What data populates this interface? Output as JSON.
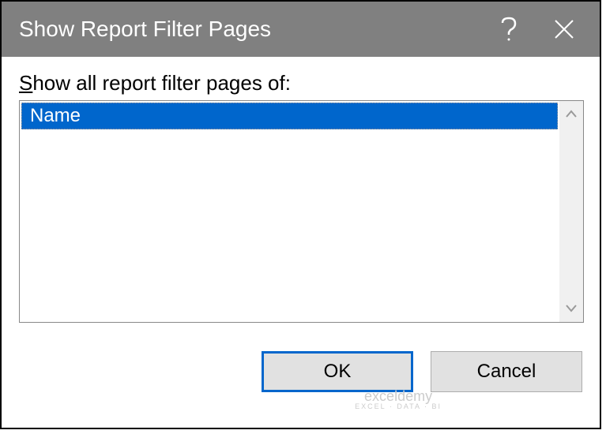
{
  "titlebar": {
    "title": "Show Report Filter Pages"
  },
  "body": {
    "label_prefix": "S",
    "label_rest": "how all report filter pages of:"
  },
  "list": {
    "items": [
      "Name"
    ]
  },
  "buttons": {
    "ok": "OK",
    "cancel": "Cancel"
  },
  "watermark": {
    "main": "exceldemy",
    "sub": "EXCEL · DATA · BI"
  }
}
